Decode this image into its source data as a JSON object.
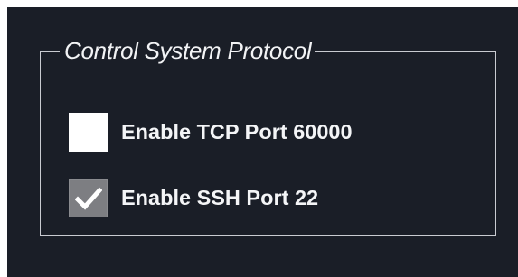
{
  "group": {
    "title": "Control System Protocol"
  },
  "options": [
    {
      "label": "Enable TCP Port 60000",
      "checked": false
    },
    {
      "label": "Enable SSH Port 22",
      "checked": true
    }
  ],
  "colors": {
    "background": "#1a1e27",
    "border": "#c9cbd1",
    "text": "#f4f5f7",
    "checkbox_unchecked": "#ffffff",
    "checkbox_checked": "#7d7e82"
  },
  "icons": {
    "checkmark": "checkmark-icon"
  }
}
